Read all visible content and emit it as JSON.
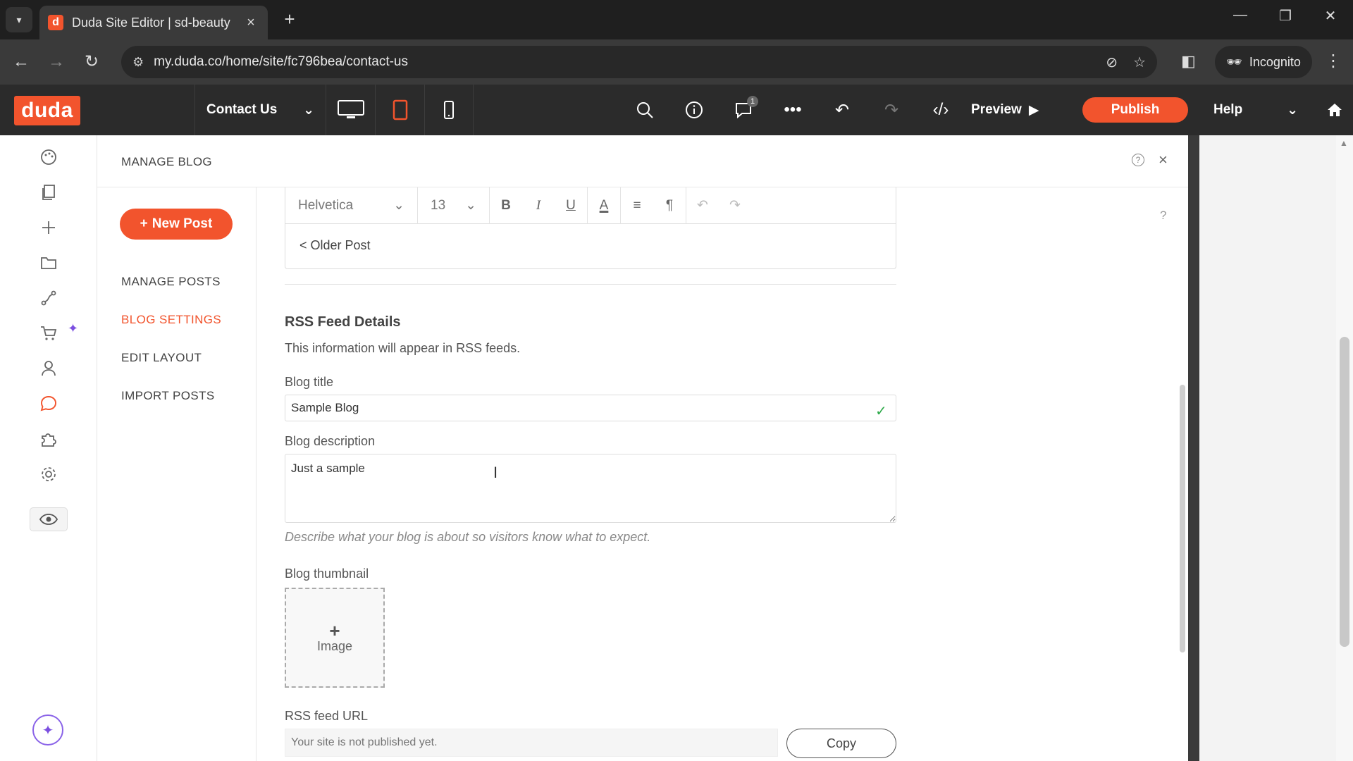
{
  "browser": {
    "tab_title": "Duda Site Editor | sd-beauty",
    "favicon_letter": "d",
    "url": "my.duda.co/home/site/fc796bea/contact-us",
    "profile_label": "Incognito"
  },
  "toolbar": {
    "logo": "duda",
    "page_name": "Contact Us",
    "messages_badge": "1",
    "preview_label": "Preview",
    "publish_label": "Publish",
    "help_label": "Help"
  },
  "panel": {
    "title": "MANAGE BLOG",
    "new_post_label": "New Post",
    "nav": [
      {
        "label": "MANAGE POSTS",
        "active": false
      },
      {
        "label": "BLOG SETTINGS",
        "active": true
      },
      {
        "label": "EDIT LAYOUT",
        "active": false
      },
      {
        "label": "IMPORT POSTS",
        "active": false
      }
    ],
    "help_mark": "?"
  },
  "editor": {
    "font": "Helvetica",
    "size": "13",
    "body_text": "< Older Post"
  },
  "rss": {
    "heading": "RSS Feed Details",
    "description": "This information will appear in RSS feeds.",
    "blog_title_label": "Blog title",
    "blog_title_value": "Sample Blog",
    "blog_description_label": "Blog description",
    "blog_description_value": "Just a sample",
    "blog_description_hint": "Describe what your blog is about so visitors know what to expect.",
    "thumbnail_label": "Blog thumbnail",
    "thumbnail_button": "Image",
    "feed_url_label": "RSS feed URL",
    "feed_url_placeholder": "Your site is not published yet.",
    "copy_label": "Copy"
  },
  "colors": {
    "accent": "#f2542d",
    "success": "#2eaa4a",
    "ai_purple": "#7b4fe0",
    "toolbar_bg": "#2b2b2b"
  }
}
